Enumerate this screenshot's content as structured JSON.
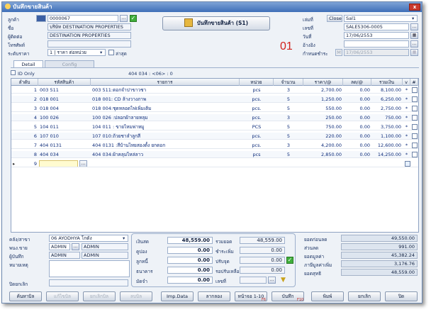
{
  "window": {
    "title": "บันทึกขายสินค้า",
    "close_label": "x"
  },
  "header": {
    "customer_label": "ลูกค้า",
    "customer_code": "0000067",
    "name_label": "ชื่อ",
    "name_value": "บริษัท DESTINATION PROPERTIES",
    "contact_label": "ผู้ติดต่อ",
    "contact_value": "DESTINATION PROPERTIES",
    "phone_label": "โทรศัพท์",
    "phone_value": "",
    "price_label": "ระดับราคา",
    "price_value": "1 | ราคา ต่อหน่วย",
    "last_label": "ล่าสุด",
    "save_button": "บันทึกขายสินค้า (S1)",
    "doc_label": "เล่มที่",
    "close_button": "Close",
    "doc_value": "Sal1",
    "docno_label": "เลขที่",
    "docno_value": "SALE5306-0005",
    "date_label": "วันที่",
    "date_value": "17/06/2553",
    "ref_label": "อ้างอิง",
    "ref_value": "",
    "due_label": "กำหนดชำระ",
    "due_prefix": "M",
    "due_value": "17/06/2553",
    "page_number": "01"
  },
  "tabs": {
    "detail": "Detail",
    "config": "Config"
  },
  "id_only_label": "ID Only",
  "grid_status": "404 034 : <06> : 0",
  "grid": {
    "columns": [
      "ลำดับ",
      "รหัสสินค้า",
      "รายการ",
      "หน่วย",
      "จำนวน",
      "ราคา/@",
      "ลด/@",
      "รวมเงิน",
      "v",
      "#"
    ],
    "rows": [
      {
        "no": "1",
        "code": "003 511",
        "desc": "003 511:ดอกจำปาขาวชา",
        "unit": "pcs",
        "qty": "3",
        "price": "2,700.00",
        "disc": "0.00",
        "total": "8,100.00",
        "v": "*"
      },
      {
        "no": "2",
        "code": "018 001",
        "desc": "018 001: CD ล้างวางภาพ",
        "unit": "pcs.",
        "qty": "5",
        "price": "1,250.00",
        "disc": "0.00",
        "total": "6,250.00",
        "v": "*"
      },
      {
        "no": "3",
        "code": "018 004",
        "desc": "018 004:ชุดหลอดไฟเพิ่มเติม",
        "unit": "pcs.",
        "qty": "5",
        "price": "550.00",
        "disc": "0.00",
        "total": "2,750.00",
        "v": "*"
      },
      {
        "no": "4",
        "code": "100 026",
        "desc": "100 026 :ปลอกผ้าลายหลุม",
        "unit": "pcs.",
        "qty": "3",
        "price": "250.00",
        "disc": "0.00",
        "total": "750.00",
        "v": "*"
      },
      {
        "no": "5",
        "code": "104 011",
        "desc": "104 011 : ขายไหมพ่าหมู",
        "unit": "PCS",
        "qty": "5",
        "price": "750.00",
        "disc": "0.00",
        "total": "3,750.00",
        "v": "*"
      },
      {
        "no": "6",
        "code": "107 010",
        "desc": "107 010:ถ้วยชาลำลูกสี",
        "unit": "pcs.",
        "qty": "5",
        "price": "220.00",
        "disc": "0.00",
        "total": "1,100.00",
        "v": "*"
      },
      {
        "no": "7",
        "code": "404 0131",
        "desc": "404 0131 :สีบ้านไทยสองตั้ง ยกดอก",
        "unit": "pcs.",
        "qty": "3",
        "price": "4,200.00",
        "disc": "0.00",
        "total": "12,600.00",
        "v": "*"
      },
      {
        "no": "8",
        "code": "404 034",
        "desc": "404 034:ผ้าคลุมไหล่ลาว",
        "unit": "pcs",
        "qty": "5",
        "price": "2,850.00",
        "disc": "0.00",
        "total": "14,250.00",
        "v": "*"
      }
    ],
    "new_row_no": "9"
  },
  "bottom_left": {
    "warehouse_label": "คลัง/สาขา",
    "warehouse_value": "06 AYODHYA โกดัง",
    "sales_label": "พนง.ขาย",
    "sales_value": "ADMIN",
    "sales_name": "ADMIN",
    "recorder_label": "ผู้บันทึก",
    "recorder_value": "ADMIN",
    "recorder_name": "ADMIN",
    "note_label": "หมายเหตุ",
    "cancel_label": "ปิดยกเลิก"
  },
  "payment": {
    "cash_label": "เงินสด",
    "cash_value": "48,559.00",
    "coupon_label": "คูปอง",
    "coupon_value": "0.00",
    "debtor_label": "ลูกหนี้",
    "debtor_value": "0.00",
    "bank_label": "ธนาคาร",
    "bank_value": "0.00",
    "deposit_label": "มัดจำ",
    "deposit_value": "0.00",
    "total_label": "รวมยอด",
    "total_value": "48,559.00",
    "extra_label": "ชำระเพิ่ม",
    "extra_value": "0.00",
    "round_label": "ปรับจุด",
    "round_value": "0.00",
    "remain_label": "รอปรับเหลือ",
    "remain_value": "0.00",
    "number_label": "เลขที่",
    "number_value": ""
  },
  "summary": {
    "gross_label": "ยอดก่อนลด",
    "gross_value": "49,550.00",
    "discount_label": "ส่วนลด",
    "discount_value": "991.00",
    "net_label": "ยอดมูลค่า",
    "net_value": "45,382.24",
    "vat_label": "ภาษีมูลค่าเพิ่ม",
    "vat_value": "3,176.76",
    "grand_label": "ยอดสุทธิ",
    "grand_value": "48,559.00"
  },
  "footer": {
    "search_bill": "ค้นหาบิล",
    "edit_bill": "แก้ไขบิล",
    "cancel_bill": "ยกเลิกบิล",
    "copy_bill": "ลบบิล",
    "imp_data": "Imp.Data",
    "copy_from": "ลากลอง",
    "page": "หน้าจอ 1-10",
    "page_key": "F6",
    "save": "บันทึก",
    "save_key": "F10",
    "print": "พิมพ์",
    "cancel": "ยกเลิก",
    "close": "ปิด"
  }
}
